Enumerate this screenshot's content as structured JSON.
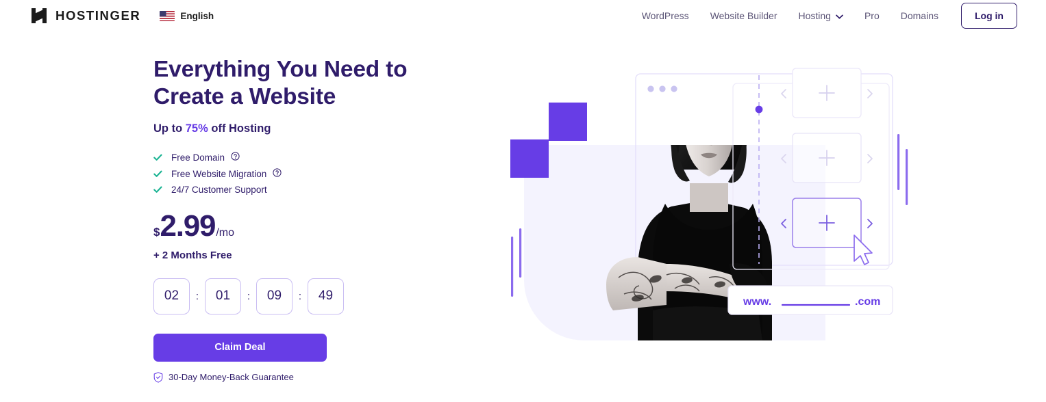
{
  "header": {
    "brand": "HOSTINGER",
    "logo_icon": "hostinger-h-logo",
    "language": {
      "label": "English",
      "flag_icon": "us-flag-icon"
    },
    "nav": [
      {
        "label": "WordPress",
        "icon": null
      },
      {
        "label": "Website Builder",
        "icon": null
      },
      {
        "label": "Hosting",
        "icon": "chevron-down-icon"
      },
      {
        "label": "Pro",
        "icon": null
      },
      {
        "label": "Domains",
        "icon": null
      }
    ],
    "login_label": "Log in"
  },
  "hero": {
    "headline_line1": "Everything You Need to",
    "headline_line2": "Create a Website",
    "subhead_prefix": "Up to ",
    "subhead_accent": "75%",
    "subhead_suffix": " off Hosting",
    "features": [
      {
        "label": "Free Domain",
        "check_icon": "check-icon",
        "info_icon": "question-circle-icon"
      },
      {
        "label": "Free Website Migration",
        "check_icon": "check-icon",
        "info_icon": "question-circle-icon"
      },
      {
        "label": "24/7 Customer Support",
        "check_icon": "check-icon",
        "info_icon": null
      }
    ],
    "price": {
      "currency": "$",
      "amount": "2.99",
      "period": "/mo"
    },
    "bonus": "+ 2 Months Free",
    "timer": {
      "days": "02",
      "hours": "01",
      "minutes": "09",
      "seconds": "49",
      "separator": ":"
    },
    "cta_label": "Claim Deal",
    "guarantee": {
      "label": "30-Day Money-Back Guarantee",
      "icon": "shield-check-icon"
    }
  },
  "illustration": {
    "domain_prefix": "www.",
    "domain_suffix": ".com",
    "card_icon": "plus-icon",
    "prev_icon": "chevron-left-icon",
    "next_icon": "chevron-right-icon",
    "cursor_icon": "mouse-pointer-icon",
    "portrait_alt": "woman-portrait"
  },
  "colors": {
    "brand_purple": "#673DE6",
    "deep_indigo": "#2F1C6A",
    "check_green": "#19B392",
    "nav_gray": "#5C5577",
    "lavender_bg": "#F4F3FE",
    "timer_border": "#C9BDF2"
  }
}
